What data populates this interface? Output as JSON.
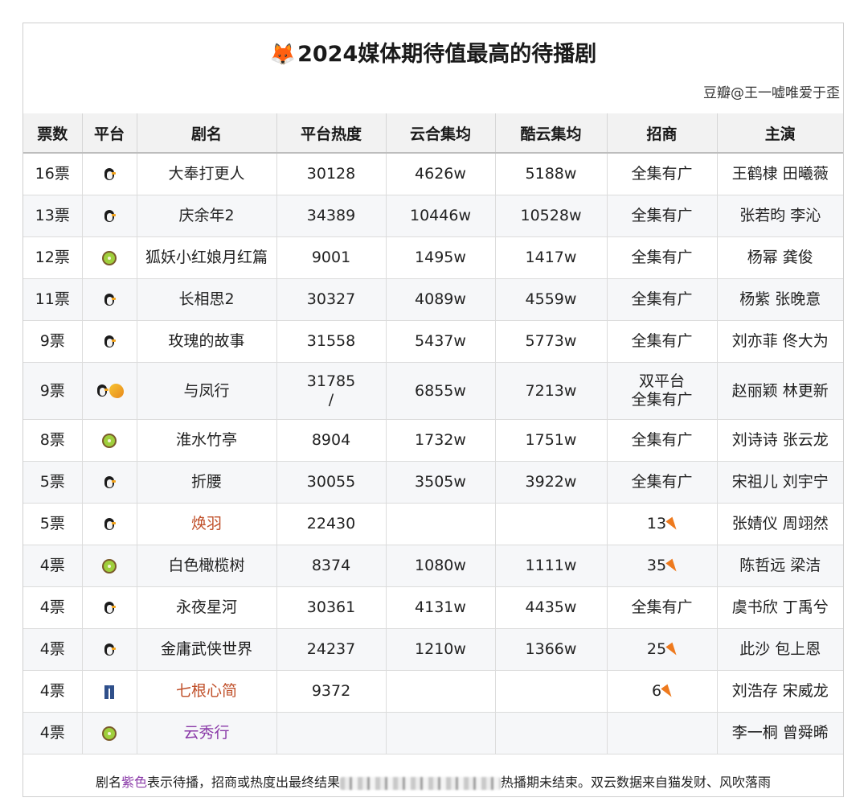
{
  "title": "2024媒体期待值最高的待播剧",
  "credit": "豆瓣@王一嘘唯爱于歪",
  "headers": [
    "票数",
    "平台",
    "剧名",
    "平台热度",
    "云合集均",
    "酷云集均",
    "招商",
    "主演"
  ],
  "rows": [
    {
      "votes": "16票",
      "platforms": [
        "penguin"
      ],
      "name": "大奉打更人",
      "heat": "30128",
      "yunhe": "4626w",
      "kuyun": "5188w",
      "ads": "全集有广",
      "cast": "王鹤棣 田曦薇"
    },
    {
      "votes": "13票",
      "platforms": [
        "penguin"
      ],
      "name": "庆余年2",
      "heat": "34389",
      "yunhe": "10446w",
      "kuyun": "10528w",
      "ads": "全集有广",
      "cast": "张若昀 李沁"
    },
    {
      "votes": "12票",
      "platforms": [
        "kiwi"
      ],
      "name": "狐妖小红娘月红篇",
      "heat": "9001",
      "yunhe": "1495w",
      "kuyun": "1417w",
      "ads": "全集有广",
      "cast": "杨幂 龚俊"
    },
    {
      "votes": "11票",
      "platforms": [
        "penguin"
      ],
      "name": "长相思2",
      "heat": "30327",
      "yunhe": "4089w",
      "kuyun": "4559w",
      "ads": "全集有广",
      "cast": "杨紫 张晚意"
    },
    {
      "votes": "9票",
      "platforms": [
        "penguin"
      ],
      "name": "玫瑰的故事",
      "heat": "31558",
      "yunhe": "5437w",
      "kuyun": "5773w",
      "ads": "全集有广",
      "cast": "刘亦菲 佟大为"
    },
    {
      "votes": "9票",
      "platforms": [
        "penguin",
        "mango"
      ],
      "name": "与凤行",
      "heat": "31785",
      "heat2": "/",
      "yunhe": "6855w",
      "kuyun": "7213w",
      "ads": "双平台",
      "ads2": "全集有广",
      "cast": "赵丽颖 林更新"
    },
    {
      "votes": "8票",
      "platforms": [
        "kiwi"
      ],
      "name": "淮水竹亭",
      "heat": "8904",
      "yunhe": "1732w",
      "kuyun": "1751w",
      "ads": "全集有广",
      "cast": "刘诗诗 张云龙"
    },
    {
      "votes": "5票",
      "platforms": [
        "penguin"
      ],
      "name": "折腰",
      "heat": "30055",
      "yunhe": "3505w",
      "kuyun": "3922w",
      "ads": "全集有广",
      "cast": "宋祖儿 刘宇宁"
    },
    {
      "votes": "5票",
      "platforms": [
        "penguin"
      ],
      "name": "焕羽",
      "name_color": "orange",
      "heat": "22430",
      "yunhe": "",
      "kuyun": "",
      "ads": "13",
      "ads_carrot": true,
      "cast": "张婧仪 周翊然"
    },
    {
      "votes": "4票",
      "platforms": [
        "kiwi"
      ],
      "name": "白色橄榄树",
      "heat": "8374",
      "yunhe": "1080w",
      "kuyun": "1111w",
      "ads": "35",
      "ads_carrot": true,
      "cast": "陈哲远 梁洁"
    },
    {
      "votes": "4票",
      "platforms": [
        "penguin"
      ],
      "name": "永夜星河",
      "heat": "30361",
      "yunhe": "4131w",
      "kuyun": "4435w",
      "ads": "全集有广",
      "cast": "虞书欣 丁禹兮"
    },
    {
      "votes": "4票",
      "platforms": [
        "penguin"
      ],
      "name": "金庸武侠世界",
      "heat": "24237",
      "yunhe": "1210w",
      "kuyun": "1366w",
      "ads": "25",
      "ads_carrot": true,
      "cast": "此沙 包上恩"
    },
    {
      "votes": "4票",
      "platforms": [
        "jeans"
      ],
      "name": "七根心简",
      "name_color": "orange",
      "heat": "9372",
      "yunhe": "",
      "kuyun": "",
      "ads": "6",
      "ads_carrot": true,
      "cast": "刘浩存 宋威龙"
    },
    {
      "votes": "4票",
      "platforms": [
        "kiwi"
      ],
      "name": "云秀行",
      "name_color": "purple",
      "heat": "",
      "yunhe": "",
      "kuyun": "",
      "ads": "",
      "cast": "李一桐 曾舜晞"
    }
  ],
  "footer": {
    "prefix": "剧名",
    "purple_word": "紫色",
    "text1": "表示待播，招商或热度出最终结果",
    "text2": "热播期未结束。双云数据来自猫发财、风吹落雨"
  }
}
